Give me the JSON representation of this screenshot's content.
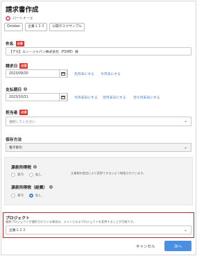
{
  "form": {
    "title": "請求書作成",
    "partner_label": "パートナー①",
    "chips": [
      "October",
      "企業１２３",
      "公開タスクサンプル"
    ]
  },
  "subject": {
    "label": "件名",
    "required": "必須",
    "value": "【デモ】エン・ジャパン株式会社（FSWE）様"
  },
  "invoice_date": {
    "label": "請求日",
    "required": "必須",
    "value": "2023/09/30",
    "link_prev": "先月末にする",
    "link_this": "今月末にする"
  },
  "due_date": {
    "label": "支払期日",
    "help": "?",
    "value": "2023/10/31",
    "link_1": "今月末日にする",
    "link_2": "翌月末日にする",
    "link_3": "翌々月末日にする"
  },
  "assignee": {
    "label": "担当者",
    "required": "必須",
    "placeholder": "選択してください"
  },
  "storage": {
    "label": "保存方法",
    "value": "電子取引"
  },
  "withholding": {
    "label": "源泉所得税",
    "help": "?",
    "option_yes": "あり",
    "option_no": "なし",
    "note": "企業側の設定により変更できないよう制限されています。"
  },
  "withholding_expense": {
    "label": "源泉所得税（経費）",
    "help": "?",
    "option_yes": "あり",
    "option_no": "なし"
  },
  "project": {
    "label": "プロジェクト",
    "note": "複数プロジェクトが選択されている場合は、メインとなるプロジェクトを変更することが可能です。",
    "value": "企業１２３"
  },
  "footer": {
    "cancel_label": "キャンセル",
    "next_label": "次へ"
  },
  "colors": {
    "accent": "#4a90e2",
    "required": "#d9362f",
    "link": "#3c79c8",
    "highlight_border": "#a4302f"
  }
}
